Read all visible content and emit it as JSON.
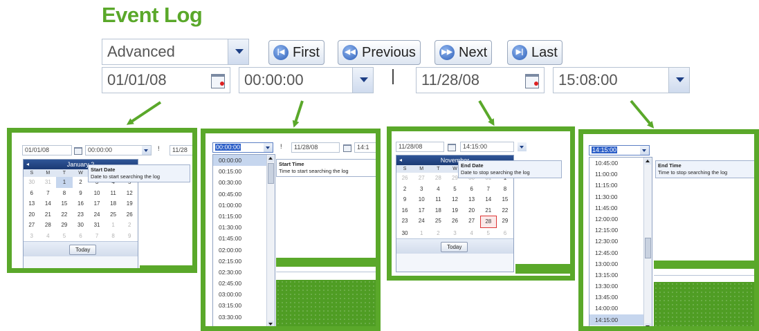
{
  "title": "Event Log",
  "toolbar": {
    "mode_value": "Advanced",
    "first_label": "First",
    "previous_label": "Previous",
    "next_label": "Next",
    "last_label": "Last",
    "start_date": "01/01/08",
    "start_time": "00:00:00",
    "range_separator": "|",
    "end_date": "11/28/08",
    "end_time": "15:08:00"
  },
  "panel_start_date": {
    "date_value": "01/01/08",
    "time_value": "00:00:00",
    "separator": "!",
    "end_date_partial": "11/28",
    "month_label": "January 2",
    "dow": [
      "S",
      "M",
      "T",
      "W",
      "T",
      "F",
      "S"
    ],
    "days": [
      {
        "d": "30",
        "c": "dim"
      },
      {
        "d": "31",
        "c": "dim"
      },
      {
        "d": "1",
        "c": "today"
      },
      {
        "d": "2",
        "c": ""
      },
      {
        "d": "3",
        "c": ""
      },
      {
        "d": "4",
        "c": ""
      },
      {
        "d": "5",
        "c": ""
      },
      {
        "d": "6",
        "c": ""
      },
      {
        "d": "7",
        "c": ""
      },
      {
        "d": "8",
        "c": ""
      },
      {
        "d": "9",
        "c": ""
      },
      {
        "d": "10",
        "c": ""
      },
      {
        "d": "11",
        "c": ""
      },
      {
        "d": "12",
        "c": ""
      },
      {
        "d": "13",
        "c": ""
      },
      {
        "d": "14",
        "c": ""
      },
      {
        "d": "15",
        "c": ""
      },
      {
        "d": "16",
        "c": ""
      },
      {
        "d": "17",
        "c": ""
      },
      {
        "d": "18",
        "c": ""
      },
      {
        "d": "19",
        "c": ""
      },
      {
        "d": "20",
        "c": ""
      },
      {
        "d": "21",
        "c": ""
      },
      {
        "d": "22",
        "c": ""
      },
      {
        "d": "23",
        "c": ""
      },
      {
        "d": "24",
        "c": ""
      },
      {
        "d": "25",
        "c": ""
      },
      {
        "d": "26",
        "c": ""
      },
      {
        "d": "27",
        "c": ""
      },
      {
        "d": "28",
        "c": ""
      },
      {
        "d": "29",
        "c": ""
      },
      {
        "d": "30",
        "c": ""
      },
      {
        "d": "31",
        "c": ""
      },
      {
        "d": "1",
        "c": "dim"
      },
      {
        "d": "2",
        "c": "dim"
      },
      {
        "d": "3",
        "c": "dim"
      },
      {
        "d": "4",
        "c": "dim"
      },
      {
        "d": "5",
        "c": "dim"
      },
      {
        "d": "6",
        "c": "dim"
      },
      {
        "d": "7",
        "c": "dim"
      },
      {
        "d": "8",
        "c": "dim"
      },
      {
        "d": "9",
        "c": "dim"
      }
    ],
    "today_label": "Today",
    "tooltip_title": "Start Date",
    "tooltip_text": "Date to start searching the log"
  },
  "panel_start_time": {
    "time_value": "00:00:00",
    "separator": "!",
    "end_date": "11/28/08",
    "end_time_partial": "14:1",
    "times": [
      "00:00:00",
      "00:15:00",
      "00:30:00",
      "00:45:00",
      "01:00:00",
      "01:15:00",
      "01:30:00",
      "01:45:00",
      "02:00:00",
      "02:15:00",
      "02:30:00",
      "02:45:00",
      "03:00:00",
      "03:15:00",
      "03:30:00"
    ],
    "tooltip_title": "Start Time",
    "tooltip_text": "Time to start searching the log"
  },
  "panel_end_date": {
    "date_value": "11/28/08",
    "time_value": "14:15:00",
    "month_label": "November",
    "dow": [
      "S",
      "M",
      "T",
      "W",
      "T",
      "F",
      "S"
    ],
    "days": [
      {
        "d": "26",
        "c": "dim"
      },
      {
        "d": "27",
        "c": "dim"
      },
      {
        "d": "28",
        "c": "dim"
      },
      {
        "d": "29",
        "c": "dim"
      },
      {
        "d": "30",
        "c": "dim"
      },
      {
        "d": "31",
        "c": "dim"
      },
      {
        "d": "1",
        "c": ""
      },
      {
        "d": "2",
        "c": ""
      },
      {
        "d": "3",
        "c": ""
      },
      {
        "d": "4",
        "c": ""
      },
      {
        "d": "5",
        "c": ""
      },
      {
        "d": "6",
        "c": ""
      },
      {
        "d": "7",
        "c": ""
      },
      {
        "d": "8",
        "c": ""
      },
      {
        "d": "9",
        "c": ""
      },
      {
        "d": "10",
        "c": ""
      },
      {
        "d": "11",
        "c": ""
      },
      {
        "d": "12",
        "c": ""
      },
      {
        "d": "13",
        "c": ""
      },
      {
        "d": "14",
        "c": ""
      },
      {
        "d": "15",
        "c": ""
      },
      {
        "d": "16",
        "c": ""
      },
      {
        "d": "17",
        "c": ""
      },
      {
        "d": "18",
        "c": ""
      },
      {
        "d": "19",
        "c": ""
      },
      {
        "d": "20",
        "c": ""
      },
      {
        "d": "21",
        "c": ""
      },
      {
        "d": "22",
        "c": ""
      },
      {
        "d": "23",
        "c": ""
      },
      {
        "d": "24",
        "c": ""
      },
      {
        "d": "25",
        "c": ""
      },
      {
        "d": "26",
        "c": ""
      },
      {
        "d": "27",
        "c": ""
      },
      {
        "d": "28",
        "c": "sel"
      },
      {
        "d": "29",
        "c": ""
      },
      {
        "d": "30",
        "c": ""
      },
      {
        "d": "1",
        "c": "dim"
      },
      {
        "d": "2",
        "c": "dim"
      },
      {
        "d": "3",
        "c": "dim"
      },
      {
        "d": "4",
        "c": "dim"
      },
      {
        "d": "5",
        "c": "dim"
      },
      {
        "d": "6",
        "c": "dim"
      }
    ],
    "today_label": "Today",
    "tooltip_title": "End Date",
    "tooltip_text": "Date to stop searching the log"
  },
  "panel_end_time": {
    "time_value": "14:15:00",
    "times": [
      "10:45:00",
      "11:00:00",
      "11:15:00",
      "11:30:00",
      "11:45:00",
      "12:00:00",
      "12:15:00",
      "12:30:00",
      "12:45:00",
      "13:00:00",
      "13:15:00",
      "13:30:00",
      "13:45:00",
      "14:00:00",
      "14:15:00"
    ],
    "tooltip_title": "End Time",
    "tooltip_text": "Time to stop searching the log"
  },
  "colors": {
    "accent_green": "#5aa82a",
    "calendar_header": "#1b3a74",
    "selection_blue": "#c6d6ee"
  }
}
